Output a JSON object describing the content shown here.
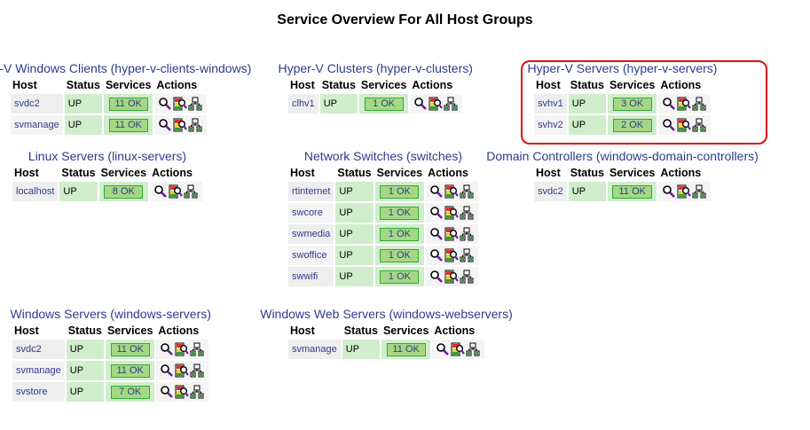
{
  "page": {
    "title": "Service Overview For All Host Groups"
  },
  "headers": {
    "host": "Host",
    "status": "Status",
    "services": "Services",
    "actions": "Actions"
  },
  "icons": [
    "magnifier-icon",
    "host-services-icon",
    "network-map-icon"
  ],
  "colors": {
    "ok": "#a5d884",
    "status_bg": "#d0edcc",
    "link": "#2d3c8c",
    "highlight": "#e01010"
  },
  "groups": [
    {
      "name": "Hyper-V Windows Clients",
      "alias": "hyper-v-clients-windows",
      "hosts": [
        {
          "host": "svdc2",
          "status": "UP",
          "services": "11 OK"
        },
        {
          "host": "svmanage",
          "status": "UP",
          "services": "11 OK"
        }
      ]
    },
    {
      "name": "Hyper-V Clusters",
      "alias": "hyper-v-clusters",
      "hosts": [
        {
          "host": "clhv1",
          "status": "UP",
          "services": "1 OK"
        }
      ]
    },
    {
      "name": "Hyper-V Servers",
      "alias": "hyper-v-servers",
      "hosts": [
        {
          "host": "svhv1",
          "status": "UP",
          "services": "3 OK"
        },
        {
          "host": "svhv2",
          "status": "UP",
          "services": "2 OK"
        }
      ]
    },
    {
      "name": "Linux Servers",
      "alias": "linux-servers",
      "hosts": [
        {
          "host": "localhost",
          "status": "UP",
          "services": "8 OK"
        }
      ]
    },
    {
      "name": "Network Switches",
      "alias": "switches",
      "hosts": [
        {
          "host": "rtinternet",
          "status": "UP",
          "services": "1 OK"
        },
        {
          "host": "swcore",
          "status": "UP",
          "services": "1 OK"
        },
        {
          "host": "swmedia",
          "status": "UP",
          "services": "1 OK"
        },
        {
          "host": "swoffice",
          "status": "UP",
          "services": "1 OK"
        },
        {
          "host": "swwifi",
          "status": "UP",
          "services": "1 OK"
        }
      ]
    },
    {
      "name": "Domain Controllers",
      "alias": "windows-domain-controllers",
      "hosts": [
        {
          "host": "svdc2",
          "status": "UP",
          "services": "11 OK"
        }
      ]
    },
    {
      "name": "Windows Servers",
      "alias": "windows-servers",
      "hosts": [
        {
          "host": "svdc2",
          "status": "UP",
          "services": "11 OK"
        },
        {
          "host": "svmanage",
          "status": "UP",
          "services": "11 OK"
        },
        {
          "host": "svstore",
          "status": "UP",
          "services": "7 OK"
        }
      ]
    },
    {
      "name": "Windows Web Servers",
      "alias": "windows-webservers",
      "hosts": [
        {
          "host": "svmanage",
          "status": "UP",
          "services": "11 OK"
        }
      ]
    }
  ]
}
